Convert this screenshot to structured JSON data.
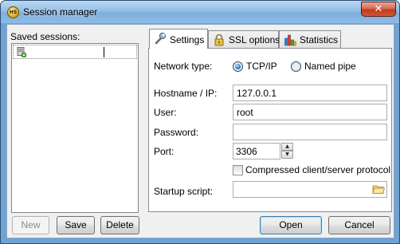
{
  "window": {
    "title": "Session manager",
    "icon_label": "HS",
    "close_label": "✕"
  },
  "left": {
    "saved_sessions_label": "Saved sessions:",
    "session_name_value": ""
  },
  "buttons": {
    "new": "New",
    "save": "Save",
    "delete": "Delete",
    "open": "Open",
    "cancel": "Cancel"
  },
  "tabs": [
    {
      "label": "Settings",
      "icon": "wrench-icon",
      "active": true
    },
    {
      "label": "SSL options",
      "icon": "lock-icon",
      "active": false
    },
    {
      "label": "Statistics",
      "icon": "bar-chart-icon",
      "active": false
    }
  ],
  "settings": {
    "network_type_label": "Network type:",
    "network_options": [
      {
        "label": "TCP/IP",
        "selected": true
      },
      {
        "label": "Named pipe",
        "selected": false
      }
    ],
    "hostname_label": "Hostname / IP:",
    "hostname_value": "127.0.0.1",
    "user_label": "User:",
    "user_value": "root",
    "password_label": "Password:",
    "password_value": "",
    "port_label": "Port:",
    "port_value": "3306",
    "compressed_label": "Compressed client/server protocol",
    "compressed_checked": false,
    "startup_script_label": "Startup script:",
    "startup_script_value": ""
  }
}
